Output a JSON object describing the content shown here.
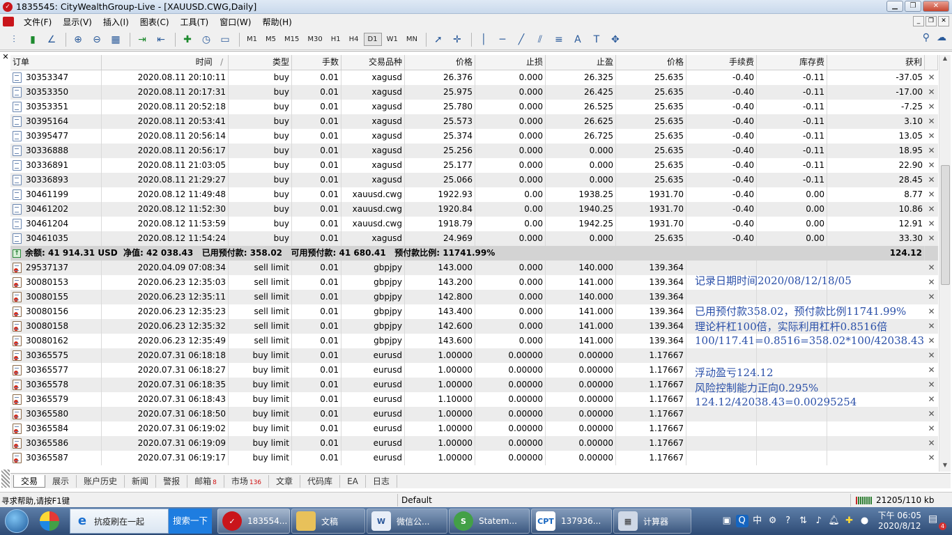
{
  "window": {
    "title": "1835545: CityWealthGroup-Live - [XAUUSD.CWG,Daily]"
  },
  "menu": [
    "文件(F)",
    "显示(V)",
    "插入(I)",
    "图表(C)",
    "工具(T)",
    "窗口(W)",
    "帮助(H)"
  ],
  "timeframes": [
    "M1",
    "M5",
    "M15",
    "M30",
    "H1",
    "H4",
    "D1",
    "W1",
    "MN"
  ],
  "active_timeframe": "D1",
  "headers": {
    "order": "订单",
    "time": "时间",
    "sort_mark": "/",
    "type": "类型",
    "lots": "手数",
    "symbol": "交易品种",
    "price": "价格",
    "sl": "止损",
    "tp": "止盈",
    "cur_price": "价格",
    "commission": "手续费",
    "swap": "库存费",
    "profit": "获利"
  },
  "open_orders": [
    {
      "order": "30353347",
      "time": "2020.08.11 20:10:11",
      "type": "buy",
      "lots": "0.01",
      "symbol": "xagusd",
      "price": "26.376",
      "sl": "0.000",
      "tp": "26.325",
      "cur": "25.635",
      "comm": "-0.40",
      "swap": "-0.11",
      "profit": "-37.05"
    },
    {
      "order": "30353350",
      "time": "2020.08.11 20:17:31",
      "type": "buy",
      "lots": "0.01",
      "symbol": "xagusd",
      "price": "25.975",
      "sl": "0.000",
      "tp": "26.425",
      "cur": "25.635",
      "comm": "-0.40",
      "swap": "-0.11",
      "profit": "-17.00"
    },
    {
      "order": "30353351",
      "time": "2020.08.11 20:52:18",
      "type": "buy",
      "lots": "0.01",
      "symbol": "xagusd",
      "price": "25.780",
      "sl": "0.000",
      "tp": "26.525",
      "cur": "25.635",
      "comm": "-0.40",
      "swap": "-0.11",
      "profit": "-7.25"
    },
    {
      "order": "30395164",
      "time": "2020.08.11 20:53:41",
      "type": "buy",
      "lots": "0.01",
      "symbol": "xagusd",
      "price": "25.573",
      "sl": "0.000",
      "tp": "26.625",
      "cur": "25.635",
      "comm": "-0.40",
      "swap": "-0.11",
      "profit": "3.10"
    },
    {
      "order": "30395477",
      "time": "2020.08.11 20:56:14",
      "type": "buy",
      "lots": "0.01",
      "symbol": "xagusd",
      "price": "25.374",
      "sl": "0.000",
      "tp": "26.725",
      "cur": "25.635",
      "comm": "-0.40",
      "swap": "-0.11",
      "profit": "13.05"
    },
    {
      "order": "30336888",
      "time": "2020.08.11 20:56:17",
      "type": "buy",
      "lots": "0.01",
      "symbol": "xagusd",
      "price": "25.256",
      "sl": "0.000",
      "tp": "0.000",
      "cur": "25.635",
      "comm": "-0.40",
      "swap": "-0.11",
      "profit": "18.95"
    },
    {
      "order": "30336891",
      "time": "2020.08.11 21:03:05",
      "type": "buy",
      "lots": "0.01",
      "symbol": "xagusd",
      "price": "25.177",
      "sl": "0.000",
      "tp": "0.000",
      "cur": "25.635",
      "comm": "-0.40",
      "swap": "-0.11",
      "profit": "22.90"
    },
    {
      "order": "30336893",
      "time": "2020.08.11 21:29:27",
      "type": "buy",
      "lots": "0.01",
      "symbol": "xagusd",
      "price": "25.066",
      "sl": "0.000",
      "tp": "0.000",
      "cur": "25.635",
      "comm": "-0.40",
      "swap": "-0.11",
      "profit": "28.45"
    },
    {
      "order": "30461199",
      "time": "2020.08.12 11:49:48",
      "type": "buy",
      "lots": "0.01",
      "symbol": "xauusd.cwg",
      "price": "1922.93",
      "sl": "0.00",
      "tp": "1938.25",
      "cur": "1931.70",
      "comm": "-0.40",
      "swap": "0.00",
      "profit": "8.77"
    },
    {
      "order": "30461202",
      "time": "2020.08.12 11:52:30",
      "type": "buy",
      "lots": "0.01",
      "symbol": "xauusd.cwg",
      "price": "1920.84",
      "sl": "0.00",
      "tp": "1940.25",
      "cur": "1931.70",
      "comm": "-0.40",
      "swap": "0.00",
      "profit": "10.86"
    },
    {
      "order": "30461204",
      "time": "2020.08.12 11:53:59",
      "type": "buy",
      "lots": "0.01",
      "symbol": "xauusd.cwg",
      "price": "1918.79",
      "sl": "0.00",
      "tp": "1942.25",
      "cur": "1931.70",
      "comm": "-0.40",
      "swap": "0.00",
      "profit": "12.91"
    },
    {
      "order": "30461035",
      "time": "2020.08.12 11:54:24",
      "type": "buy",
      "lots": "0.01",
      "symbol": "xagusd",
      "price": "24.969",
      "sl": "0.000",
      "tp": "0.000",
      "cur": "25.635",
      "comm": "-0.40",
      "swap": "0.00",
      "profit": "33.30"
    }
  ],
  "summary": {
    "text": "余额: 41 914.31 USD  净值: 42 038.43   已用预付款: 358.02   可用预付款: 41 680.41   预付款比例: 11741.99%",
    "total": "124.12"
  },
  "pending_orders": [
    {
      "order": "29537137",
      "time": "2020.04.09 07:08:34",
      "type": "sell limit",
      "lots": "0.01",
      "symbol": "gbpjpy",
      "price": "143.000",
      "sl": "0.000",
      "tp": "140.000",
      "cur": "139.364"
    },
    {
      "order": "30080153",
      "time": "2020.06.23 12:35:03",
      "type": "sell limit",
      "lots": "0.01",
      "symbol": "gbpjpy",
      "price": "143.200",
      "sl": "0.000",
      "tp": "141.000",
      "cur": "139.364"
    },
    {
      "order": "30080155",
      "time": "2020.06.23 12:35:11",
      "type": "sell limit",
      "lots": "0.01",
      "symbol": "gbpjpy",
      "price": "142.800",
      "sl": "0.000",
      "tp": "140.000",
      "cur": "139.364"
    },
    {
      "order": "30080156",
      "time": "2020.06.23 12:35:23",
      "type": "sell limit",
      "lots": "0.01",
      "symbol": "gbpjpy",
      "price": "143.400",
      "sl": "0.000",
      "tp": "141.000",
      "cur": "139.364"
    },
    {
      "order": "30080158",
      "time": "2020.06.23 12:35:32",
      "type": "sell limit",
      "lots": "0.01",
      "symbol": "gbpjpy",
      "price": "142.600",
      "sl": "0.000",
      "tp": "141.000",
      "cur": "139.364"
    },
    {
      "order": "30080162",
      "time": "2020.06.23 12:35:49",
      "type": "sell limit",
      "lots": "0.01",
      "symbol": "gbpjpy",
      "price": "143.600",
      "sl": "0.000",
      "tp": "141.000",
      "cur": "139.364"
    },
    {
      "order": "30365575",
      "time": "2020.07.31 06:18:18",
      "type": "buy limit",
      "lots": "0.01",
      "symbol": "eurusd",
      "price": "1.00000",
      "sl": "0.00000",
      "tp": "0.00000",
      "cur": "1.17667"
    },
    {
      "order": "30365577",
      "time": "2020.07.31 06:18:27",
      "type": "buy limit",
      "lots": "0.01",
      "symbol": "eurusd",
      "price": "1.00000",
      "sl": "0.00000",
      "tp": "0.00000",
      "cur": "1.17667"
    },
    {
      "order": "30365578",
      "time": "2020.07.31 06:18:35",
      "type": "buy limit",
      "lots": "0.01",
      "symbol": "eurusd",
      "price": "1.00000",
      "sl": "0.00000",
      "tp": "0.00000",
      "cur": "1.17667"
    },
    {
      "order": "30365579",
      "time": "2020.07.31 06:18:43",
      "type": "buy limit",
      "lots": "0.01",
      "symbol": "eurusd",
      "price": "1.10000",
      "sl": "0.00000",
      "tp": "0.00000",
      "cur": "1.17667"
    },
    {
      "order": "30365580",
      "time": "2020.07.31 06:18:50",
      "type": "buy limit",
      "lots": "0.01",
      "symbol": "eurusd",
      "price": "1.00000",
      "sl": "0.00000",
      "tp": "0.00000",
      "cur": "1.17667"
    },
    {
      "order": "30365584",
      "time": "2020.07.31 06:19:02",
      "type": "buy limit",
      "lots": "0.01",
      "symbol": "eurusd",
      "price": "1.00000",
      "sl": "0.00000",
      "tp": "0.00000",
      "cur": "1.17667"
    },
    {
      "order": "30365586",
      "time": "2020.07.31 06:19:09",
      "type": "buy limit",
      "lots": "0.01",
      "symbol": "eurusd",
      "price": "1.00000",
      "sl": "0.00000",
      "tp": "0.00000",
      "cur": "1.17667"
    },
    {
      "order": "30365587",
      "time": "2020.07.31 06:19:17",
      "type": "buy limit",
      "lots": "0.01",
      "symbol": "eurusd",
      "price": "1.00000",
      "sl": "0.00000",
      "tp": "0.00000",
      "cur": "1.17667"
    }
  ],
  "annotations": {
    "line1": "记录日期时间2020/08/12/18/05",
    "line2": "已用预付款358.02，预付款比例11741.99%",
    "line3": "理论杆杠100倍，实际利用杠杆0.8516倍",
    "line4": "100/117.41=0.8516=358.02*100/42038.43",
    "line5": "浮动盈亏124.12",
    "line6": "风险控制能力正向0.295%",
    "line7": "124.12/42038.43=0.00295254"
  },
  "tabs": [
    {
      "label": "交易",
      "badge": ""
    },
    {
      "label": "展示",
      "badge": ""
    },
    {
      "label": "账户历史",
      "badge": ""
    },
    {
      "label": "新闻",
      "badge": ""
    },
    {
      "label": "警报",
      "badge": ""
    },
    {
      "label": "邮箱",
      "badge": "8"
    },
    {
      "label": "市场",
      "badge": "136"
    },
    {
      "label": "文章",
      "badge": ""
    },
    {
      "label": "代码库",
      "badge": ""
    },
    {
      "label": "EA",
      "badge": ""
    },
    {
      "label": "日志",
      "badge": ""
    }
  ],
  "status": {
    "help": "寻求帮助,请按F1键",
    "profile": "Default",
    "traffic": "21205/110 kb"
  },
  "taskbar": {
    "ie_text": "抗疫刷在一起",
    "search_btn": "搜索一下",
    "tasks": [
      {
        "label": "183554...",
        "icon": "mt4-icon"
      },
      {
        "label": "文稿",
        "icon": "folder-icon"
      },
      {
        "label": "微信公...",
        "icon": "word-icon"
      },
      {
        "label": "Statem...",
        "icon": "browser-icon"
      },
      {
        "label": "137936...",
        "icon": "cpt-icon"
      },
      {
        "label": "计算器",
        "icon": "calculator-icon"
      }
    ],
    "tray_lang": "中",
    "time": "下午 06:05",
    "date": "2020/8/12",
    "notif_count": "4"
  },
  "colors": {
    "annotation": "#2a4fa8",
    "summary_bg": "#d3d3d3",
    "alt_row": "#ececec",
    "taskbar": "#3a5a86"
  }
}
